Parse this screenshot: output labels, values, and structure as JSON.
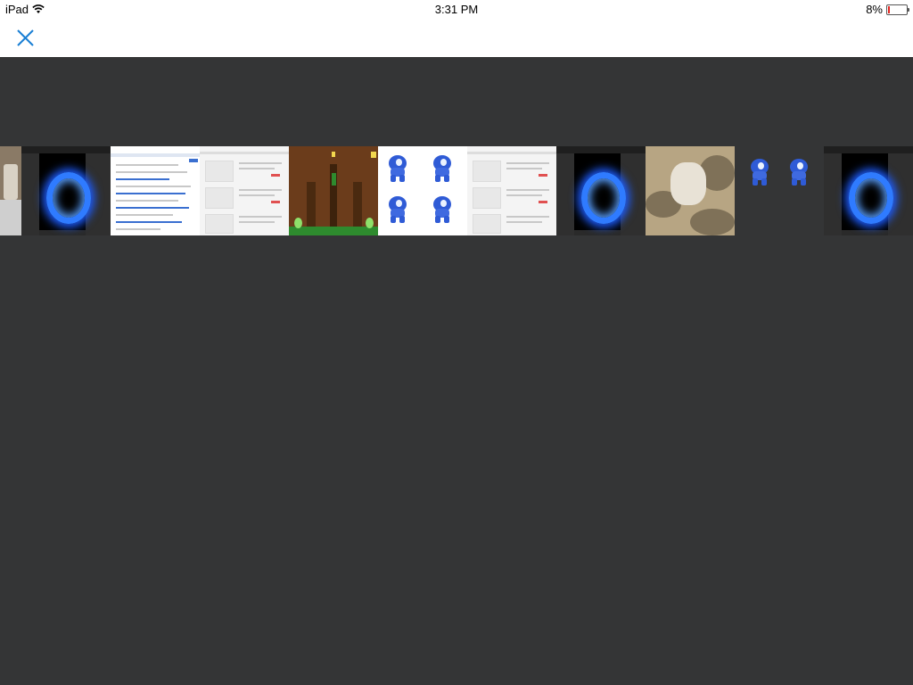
{
  "status": {
    "device": "iPad",
    "time": "3:31 PM",
    "battery": "8%",
    "battery_level": 0.08
  },
  "nav": {
    "close_icon": "close-icon"
  },
  "colors": {
    "accent": "#1a7fd4",
    "background": "#343536",
    "battery_low": "#e3251f"
  },
  "thumbnails": [
    {
      "type": "app-screenshot"
    },
    {
      "type": "document"
    },
    {
      "type": "document"
    },
    {
      "type": "game-screenshot"
    },
    {
      "type": "sprite-sheet"
    },
    {
      "type": "document"
    },
    {
      "type": "app-screenshot"
    },
    {
      "type": "photo"
    },
    {
      "type": "sprite-sheet"
    },
    {
      "type": "app-screenshot"
    }
  ]
}
